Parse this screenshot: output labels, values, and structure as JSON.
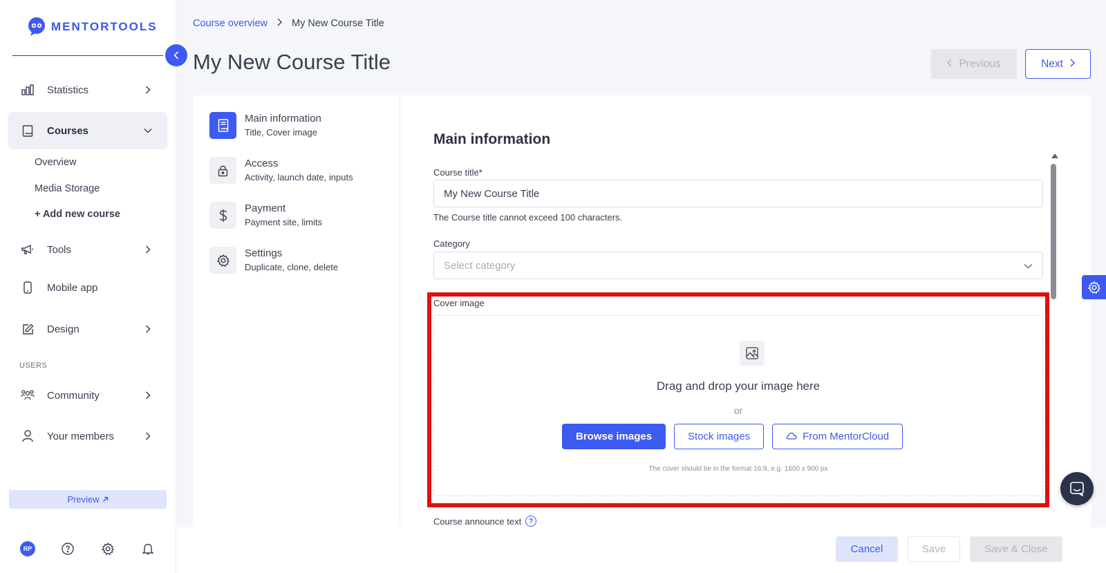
{
  "brand": {
    "name": "MENTORTOOLS",
    "accent": "#3d5af1"
  },
  "sidebar": {
    "items": [
      {
        "label": "Statistics",
        "icon": "bar-chart-icon"
      },
      {
        "label": "Courses",
        "icon": "book-icon"
      },
      {
        "label": "Tools",
        "icon": "megaphone-icon"
      },
      {
        "label": "Mobile app",
        "icon": "mobile-icon"
      },
      {
        "label": "Design",
        "icon": "pencil-icon"
      },
      {
        "label": "Community",
        "icon": "people-icon"
      },
      {
        "label": "Your members",
        "icon": "user-icon"
      }
    ],
    "courses_sub": [
      {
        "label": "Overview"
      },
      {
        "label": "Media Storage"
      },
      {
        "label": "+ Add new course"
      }
    ],
    "section_users": "USERS",
    "preview_label": "Preview",
    "avatar_initials": "RP"
  },
  "breadcrumb": {
    "parent": "Course overview",
    "current": "My New Course Title"
  },
  "page": {
    "title": "My New Course Title"
  },
  "nav": {
    "previous": "Previous",
    "next": "Next"
  },
  "steps": [
    {
      "title": "Main information",
      "subtitle": "Title, Cover image"
    },
    {
      "title": "Access",
      "subtitle": "Activity, launch date, inputs"
    },
    {
      "title": "Payment",
      "subtitle": "Payment site, limits"
    },
    {
      "title": "Settings",
      "subtitle": "Duplicate, clone, delete"
    }
  ],
  "form": {
    "heading": "Main information",
    "course_title_label": "Course title*",
    "course_title_value": "My New Course Title",
    "course_title_help": "The Course title cannot exceed 100 characters.",
    "category_label": "Category",
    "category_placeholder": "Select category",
    "cover_label": "Cover image",
    "dropzone": {
      "title": "Drag and drop your image here",
      "or": "or",
      "browse": "Browse images",
      "stock": "Stock images",
      "cloud": "From MentorCloud",
      "note": "The cover should be in the format 16:9, e.g. 1600 x 900 px"
    },
    "announce_label": "Course announce text",
    "help_glyph": "?"
  },
  "footer": {
    "cancel": "Cancel",
    "save": "Save",
    "save_close": "Save & Close"
  }
}
